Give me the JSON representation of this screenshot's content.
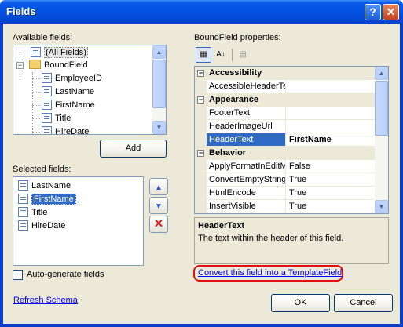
{
  "window": {
    "title": "Fields"
  },
  "titlebar_buttons": {
    "help": "?",
    "close": "✕"
  },
  "available": {
    "label": "Available fields:",
    "items": [
      "(All Fields)",
      "BoundField",
      "EmployeeID",
      "LastName",
      "FirstName",
      "Title",
      "HireDate"
    ]
  },
  "add_button": "Add",
  "selected": {
    "label": "Selected fields:",
    "items": [
      "LastName",
      "FirstName",
      "Title",
      "HireDate"
    ],
    "selected_index": 1
  },
  "auto_generate": {
    "label": "Auto-generate fields",
    "checked": false
  },
  "refresh_schema": "Refresh Schema",
  "properties": {
    "label": "BoundField properties:",
    "rows": [
      {
        "type": "category",
        "name": "Accessibility",
        "expander": "−"
      },
      {
        "type": "prop",
        "name": "AccessibleHeaderTe",
        "value": ""
      },
      {
        "type": "category",
        "name": "Appearance",
        "expander": "−"
      },
      {
        "type": "prop",
        "name": "FooterText",
        "value": ""
      },
      {
        "type": "prop",
        "name": "HeaderImageUrl",
        "value": ""
      },
      {
        "type": "prop",
        "name": "HeaderText",
        "value": "FirstName",
        "selected": true
      },
      {
        "type": "category",
        "name": "Behavior",
        "expander": "−"
      },
      {
        "type": "prop",
        "name": "ApplyFormatInEditM",
        "value": "False"
      },
      {
        "type": "prop",
        "name": "ConvertEmptyString",
        "value": "True"
      },
      {
        "type": "prop",
        "name": "HtmlEncode",
        "value": "True"
      },
      {
        "type": "prop",
        "name": "InsertVisible",
        "value": "True"
      }
    ]
  },
  "description": {
    "title": "HeaderText",
    "body": "The text within the header of this field."
  },
  "convert_link": "Convert this field into a TemplateField",
  "ok_button": "OK",
  "cancel_button": "Cancel",
  "icons": {
    "up": "▲",
    "down": "▼",
    "delete": "✕",
    "scroll_up": "▲",
    "scroll_down": "▼",
    "categorized": "▦",
    "alphabetical": "A↓",
    "property_pages": "▤"
  },
  "colors": {
    "titlebar": "#0551e2",
    "selection": "#316ac5",
    "highlight_ring": "#e01010",
    "delete_icon": "#e02020"
  }
}
